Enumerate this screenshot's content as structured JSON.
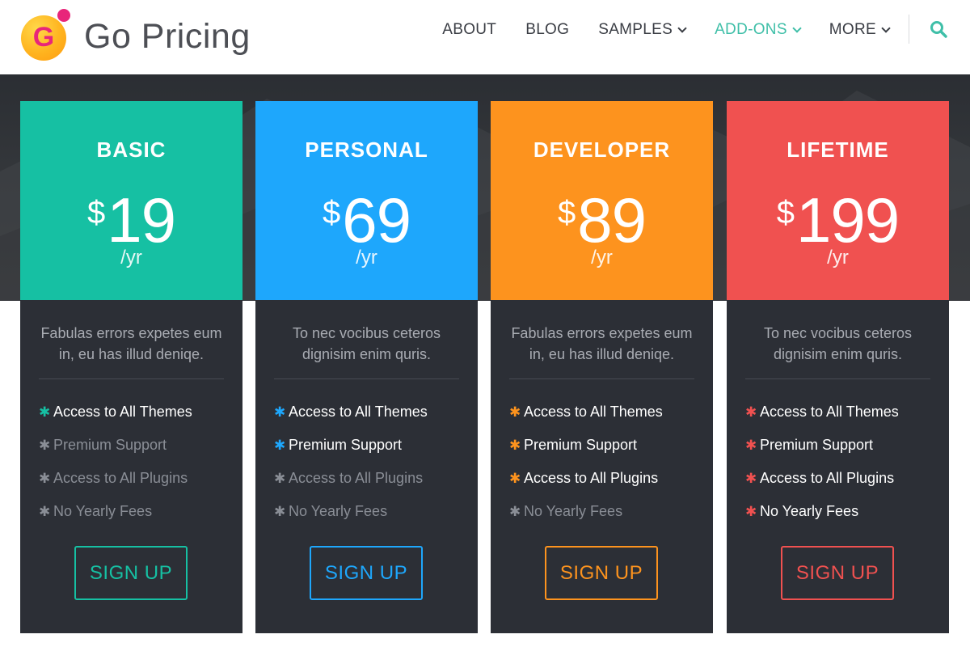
{
  "header": {
    "logo_letter": "G",
    "logo_text": "Go Pricing",
    "nav": [
      {
        "label": "ABOUT",
        "dropdown": false,
        "active": false
      },
      {
        "label": "BLOG",
        "dropdown": false,
        "active": false
      },
      {
        "label": "SAMPLES",
        "dropdown": true,
        "active": false
      },
      {
        "label": "ADD-ONS",
        "dropdown": true,
        "active": true
      },
      {
        "label": "MORE",
        "dropdown": true,
        "active": false
      }
    ],
    "search_icon": "search-icon"
  },
  "colors": {
    "basic": "#16c0a3",
    "personal": "#1ea7fc",
    "developer": "#fd931e",
    "lifetime": "#f05150",
    "card_body": "#2c2f36",
    "nav_active": "#3fbfa8"
  },
  "plans": [
    {
      "name": "BASIC",
      "currency": "$",
      "price": "19",
      "period": "/yr",
      "description": "Fabulas errors expetes eum in, eu has illud deniqe.",
      "features": [
        {
          "label": "Access to All Themes",
          "included": true
        },
        {
          "label": "Premium Support",
          "included": false
        },
        {
          "label": "Access to All Plugins",
          "included": false
        },
        {
          "label": "No Yearly Fees",
          "included": false
        }
      ],
      "button": "SIGN UP"
    },
    {
      "name": "PERSONAL",
      "currency": "$",
      "price": "69",
      "period": "/yr",
      "description": "To nec vocibus ceteros dignisim enim quris.",
      "features": [
        {
          "label": "Access to All Themes",
          "included": true
        },
        {
          "label": "Premium Support",
          "included": true
        },
        {
          "label": "Access to All Plugins",
          "included": false
        },
        {
          "label": "No Yearly Fees",
          "included": false
        }
      ],
      "button": "SIGN UP"
    },
    {
      "name": "DEVELOPER",
      "currency": "$",
      "price": "89",
      "period": "/yr",
      "description": "Fabulas errors expetes eum in, eu has illud deniqe.",
      "features": [
        {
          "label": "Access to All Themes",
          "included": true
        },
        {
          "label": "Premium Support",
          "included": true
        },
        {
          "label": "Access to All Plugins",
          "included": true
        },
        {
          "label": "No Yearly Fees",
          "included": false
        }
      ],
      "button": "SIGN UP"
    },
    {
      "name": "LIFETIME",
      "currency": "$",
      "price": "199",
      "period": "/yr",
      "description": "To nec vocibus ceteros dignisim enim quris.",
      "features": [
        {
          "label": "Access to All Themes",
          "included": true
        },
        {
          "label": "Premium Support",
          "included": true
        },
        {
          "label": "Access to All Plugins",
          "included": true
        },
        {
          "label": "No Yearly Fees",
          "included": true
        }
      ],
      "button": "SIGN UP"
    }
  ]
}
